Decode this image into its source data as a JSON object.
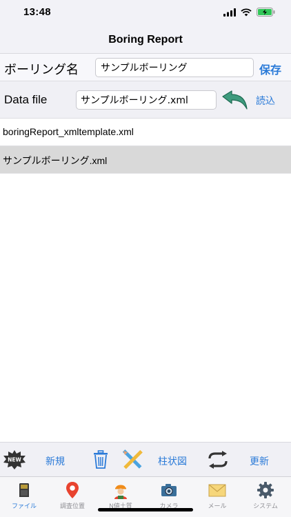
{
  "status": {
    "time": "13:48"
  },
  "header": {
    "title": "Boring Report"
  },
  "boring": {
    "label": "ボーリング名",
    "value": "サンプルボーリング",
    "save_label": "保存"
  },
  "datafile": {
    "label": "Data file",
    "value": "サンプルボーリング.xml",
    "load_label": "読込"
  },
  "files": [
    {
      "name": "boringReport_xmltemplate.xml"
    },
    {
      "name": "サンプルボーリング.xml"
    }
  ],
  "toolbar": {
    "new_badge": "NEW",
    "new_label": "新規",
    "column_label": "柱状図",
    "refresh_label": "更新"
  },
  "tabs": [
    {
      "label": "ファイル",
      "icon": "sd-card-icon",
      "active": true
    },
    {
      "label": "調査位置",
      "icon": "location-pin-icon"
    },
    {
      "label": "N値土質",
      "icon": "worker-icon"
    },
    {
      "label": "カメラ",
      "icon": "camera-icon"
    },
    {
      "label": "メール",
      "icon": "mail-icon"
    },
    {
      "label": "システム",
      "icon": "gear-icon"
    }
  ],
  "colors": {
    "accent": "#2a7ad8",
    "arrow": "#3e9b7e",
    "selected_row": "#d9d9d9"
  }
}
